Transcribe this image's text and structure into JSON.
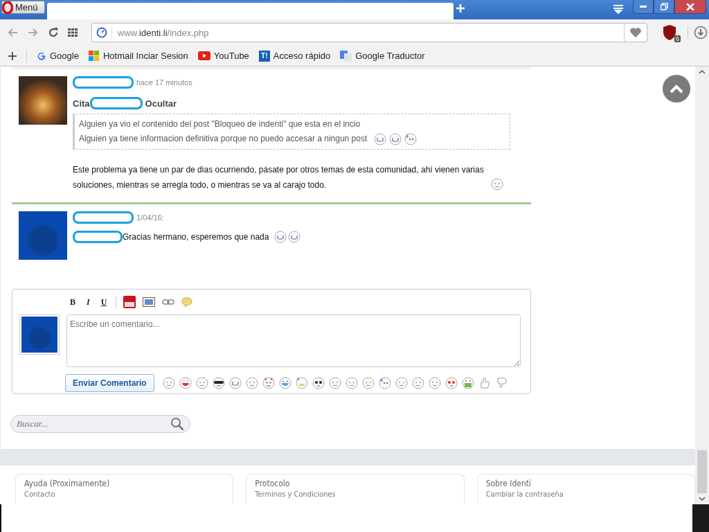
{
  "browser": {
    "menu_label": "Menú",
    "url": {
      "prefix": "www.",
      "domain": "identi.li",
      "path": "/index.php"
    },
    "extension_badge": "6",
    "bookmarks": [
      {
        "label": "Google"
      },
      {
        "label": "Hotmail Inciar Sesion"
      },
      {
        "label": "YouTube"
      },
      {
        "icon_text": "T!",
        "label": "Acceso rápido"
      },
      {
        "label": "Google Traductor"
      }
    ]
  },
  "comments": [
    {
      "time": "hace 17 minutos",
      "quote": {
        "cite_label": "Cita",
        "hide_label": "Ocultar",
        "lines": [
          "Alguien ya vio el contenido del post \"Bloqueo de indenti\" que esta en el incio",
          "Alguien ya tiene informacion definitiva porque no puedo accesar a ningun post"
        ]
      },
      "body": "Este problema ya tiene un par de dias ocurriendo, pásate por otros temas de esta comunidad, ahí vienen varias soluciones, mientras se arregla todo, o mientras se va al carajo todo."
    },
    {
      "time": "1/04/16:",
      "body": "Gracias hermano, esperemos que nada"
    }
  ],
  "composer": {
    "format_buttons": [
      {
        "kind": "bold",
        "label": "B"
      },
      {
        "kind": "italic",
        "label": "I"
      },
      {
        "kind": "underline",
        "label": "U"
      }
    ],
    "placeholder": "Escribe un comentario...",
    "submit": "Enviar Comentario"
  },
  "search": {
    "placeholder": "Buscar..."
  },
  "footer": [
    {
      "title": "Ayuda (Proximamente)",
      "link": "Contacto"
    },
    {
      "title": "Protocolo",
      "link": "Terminos y Condiciones"
    },
    {
      "title": "Sobre Identi",
      "link": "Cambiar la contraseña"
    }
  ]
}
